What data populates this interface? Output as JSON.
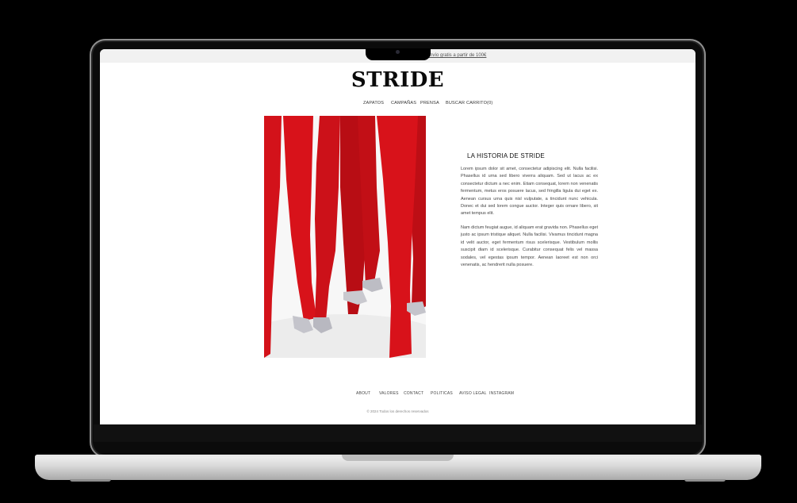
{
  "announcement": {
    "text": "Envío gratis a partir de 100€"
  },
  "brand": {
    "logo": "STRIDE"
  },
  "nav": {
    "items": [
      "ZAPATOS",
      "CAMPAÑAS",
      "PRENSA",
      "BUSCAR",
      "CARRITO(0)"
    ]
  },
  "story": {
    "title": "LA HISTORIA DE STRIDE",
    "paragraph1": "Lorem ipsum dolor sit amet, consectetur adipiscing elit. Nulla facilisi. Phasellus id urna sed libero viverra aliquam. Sed ut lacus ac ex consectetur dictum a nec enim. Etiam consequat, lorem non venenatis fermentum, metus eros posuere lacus, sed fringilla ligula dui eget ex. Aenean cursus urna quis nisl vulputate, a tincidunt nunc vehicula. Donec et dui sed lorem congue auctor. Integer quis ornare libero, sit amet tempus elit.",
    "paragraph2": "Nam dictum feugiat augue, id aliquam erat gravida non. Phasellus eget justo ac ipsum tristique aliquet. Nulla facilisi. Vivamus tincidunt magna id velit auctor, eget fermentum risus scelerisque. Vestibulum mollis suscipit diam id scelerisque. Curabitur consequat felis vel massa sodales, vel egestas ipsum tempor. Aenean laoreet est non orci venenatis, ac hendrerit nulla posuere."
  },
  "footer": {
    "links": [
      "ABOUT",
      "VALORES",
      "CONTACT",
      "POLITICAS",
      "AVISO LEGAL",
      "INSTAGRAM"
    ],
    "copyright": "© 2024 Todos los derechos reservados"
  },
  "colors": {
    "tights_red": "#d8121a",
    "shoe_silver": "#bdbdc4",
    "page_bg": "#ffffff"
  }
}
